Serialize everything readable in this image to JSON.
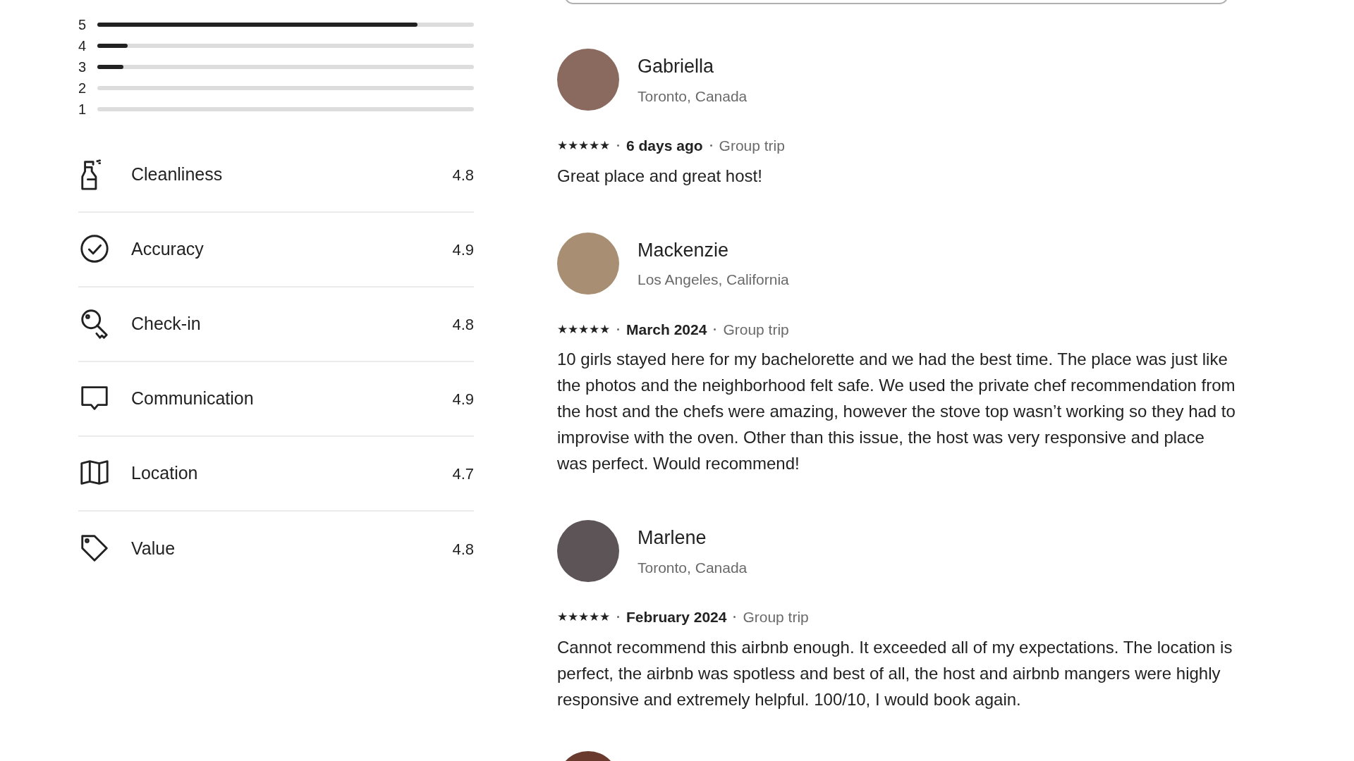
{
  "rating_distribution": [
    {
      "label": "5",
      "level": 0.85
    },
    {
      "label": "4",
      "level": 0.08
    },
    {
      "label": "3",
      "level": 0.07
    },
    {
      "label": "2",
      "level": 0
    },
    {
      "label": "1",
      "level": 0
    }
  ],
  "categories": [
    {
      "kind": "spray",
      "label": "Cleanliness",
      "score": "4.8"
    },
    {
      "kind": "check",
      "label": "Accuracy",
      "score": "4.9"
    },
    {
      "kind": "key",
      "label": "Check-in",
      "score": "4.8"
    },
    {
      "kind": "chat",
      "label": "Communication",
      "score": "4.9"
    },
    {
      "kind": "map",
      "label": "Location",
      "score": "4.7"
    },
    {
      "kind": "tag",
      "label": "Value",
      "score": "4.8"
    }
  ],
  "reviews": [
    {
      "name": "Gabriella",
      "location": "Toronto, Canada",
      "stars": 5,
      "date": "6 days ago",
      "trip": "Group trip",
      "text": "Great place and great host!"
    },
    {
      "name": "Mackenzie",
      "location": "Los Angeles, California",
      "stars": 5,
      "date": "March 2024",
      "trip": "Group trip",
      "text": "10 girls stayed here for my bachelorette and we had the best time. The place was just like the photos and the neighborhood felt safe. We used the private chef recommendation from the host and the chefs were amazing, however the stove top wasn’t working so they had to improvise with the oven. Other than this issue, the host was very responsive and place was perfect. Would recommend!"
    },
    {
      "name": "Marlene",
      "location": "Toronto, Canada",
      "stars": 5,
      "date": "February 2024",
      "trip": "Group trip",
      "text": "Cannot recommend this airbnb enough. It exceeded all of my expectations. The location is perfect, the airbnb was spotless and best of all, the host and airbnb mangers were highly responsive and extremely helpful. 100/10, I would book again."
    }
  ]
}
